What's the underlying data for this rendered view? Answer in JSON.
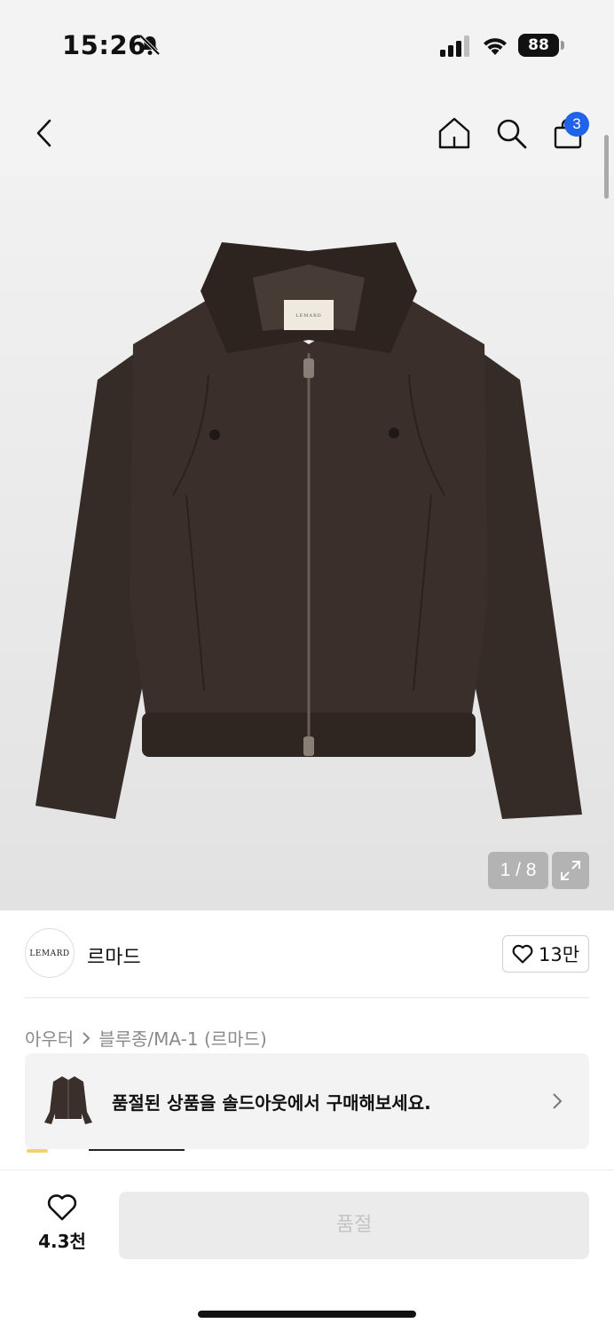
{
  "status": {
    "time": "15:26",
    "battery": "88"
  },
  "nav": {
    "cart_count": "3"
  },
  "gallery": {
    "counter": "1 / 8",
    "label_brand": "LEMARD"
  },
  "brand": {
    "logo_text": "LEMARD",
    "name": "르마드",
    "likes": "13만"
  },
  "breadcrumb": {
    "category": "아우터",
    "subcategory": "블루종/MA-1 (르마드)"
  },
  "banner": {
    "text": "품절된 상품을 솔드아웃에서 구매해보세요."
  },
  "bottom": {
    "wish_count": "4.3천",
    "buy_label": "품절"
  },
  "colors": {
    "badge": "#1e63e9",
    "jacket": "#3a2f2a",
    "disabled_button": "#ebebeb"
  },
  "icons": [
    "bell-slash-icon",
    "signal-icon",
    "wifi-icon",
    "battery-icon",
    "back-arrow-icon",
    "home-icon",
    "search-icon",
    "shopping-bag-icon",
    "expand-icon",
    "heart-icon",
    "chevron-right-icon"
  ]
}
